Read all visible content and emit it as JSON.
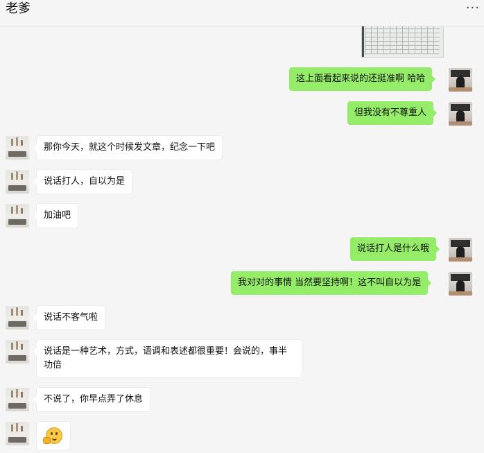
{
  "header": {
    "title": "老爹",
    "more_icon": "more-dots-icon",
    "more_glyph": "···"
  },
  "messages": [
    {
      "side": "out",
      "type": "image",
      "description_icon": "screenshot-thumbnail"
    },
    {
      "side": "out",
      "text": "这上面看起来说的还挺准啊 哈哈"
    },
    {
      "side": "out",
      "text": "但我没有不尊重人"
    },
    {
      "side": "in",
      "text": "那你今天，就这个时候发文章，纪念一下吧"
    },
    {
      "side": "in",
      "text": "说话打人，自以为是"
    },
    {
      "side": "in",
      "text": "加油吧"
    },
    {
      "side": "out",
      "text": "说话打人是什么哦"
    },
    {
      "side": "out",
      "text": "我对对的事情 当然要坚持啊！这不叫自以为是"
    },
    {
      "side": "in",
      "text": "说话不客气啦"
    },
    {
      "side": "in",
      "text": "说话是一种艺术，方式，语调和表述都很重要！会说的，事半功倍"
    },
    {
      "side": "in",
      "text": "不说了，你早点弄了休息"
    },
    {
      "side": "in",
      "type": "emoji",
      "emoji_icon": "thinking-emoji-icon"
    }
  ],
  "colors": {
    "outgoing_bubble": "#95ec69",
    "incoming_bubble": "#ffffff",
    "background": "#f5f5f5"
  }
}
